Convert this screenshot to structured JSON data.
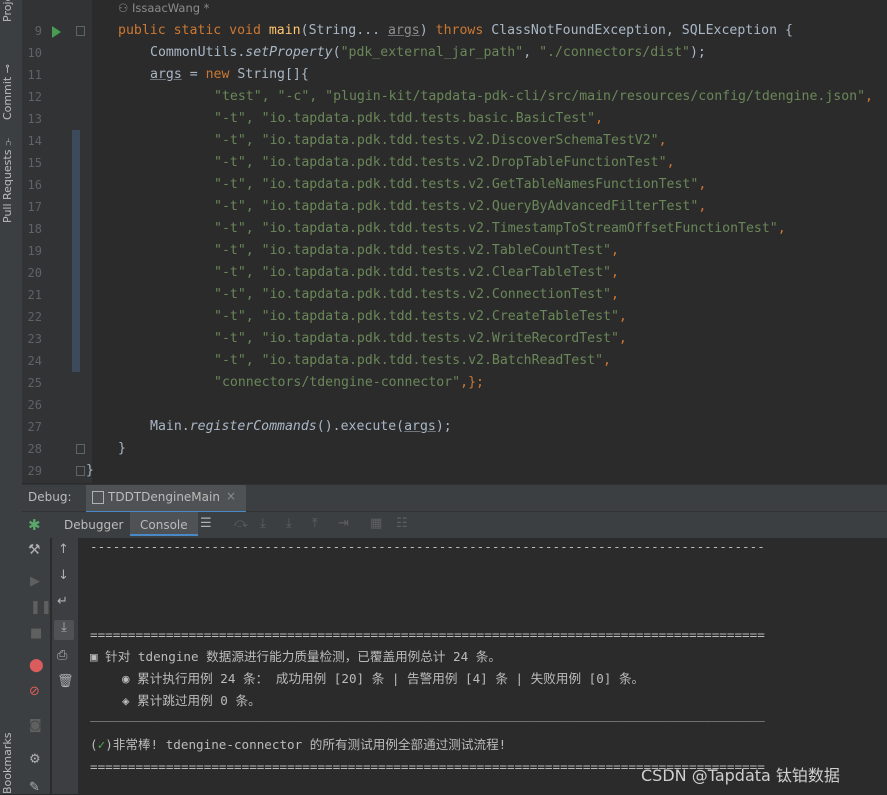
{
  "sidebar": {
    "project_label": "Project",
    "commit_label": "Commit",
    "pull_requests_label": "Pull Requests",
    "bookmarks_label": "Bookmarks"
  },
  "editor": {
    "author": "IssaacWang *",
    "line_numbers": [
      "9",
      "10",
      "11",
      "12",
      "13",
      "14",
      "15",
      "16",
      "17",
      "18",
      "19",
      "20",
      "21",
      "22",
      "23",
      "24",
      "25",
      "26",
      "27",
      "28",
      "29"
    ],
    "lines": {
      "l9": {
        "kw1": "public static void ",
        "fn": "main",
        "p1": "(String... ",
        "param": "args",
        "p2": ") ",
        "kw2": "throws ",
        "rest": "ClassNotFoundException, SQLException {"
      },
      "l10": {
        "a": "CommonUtils.",
        "fn": "setProperty",
        "b": "(",
        "s1": "\"pdk_external_jar_path\"",
        "c": ", ",
        "s2": "\"./connectors/dist\"",
        "d": ");"
      },
      "l11": {
        "param": "args",
        "a": " = ",
        "kw": "new ",
        "b": "String[]{"
      },
      "l12": {
        "s": "\"test\", \"-c\", \"plugin-kit/tapdata-pdk-cli/src/main/resources/config/tdengine.json\"",
        "c": ","
      },
      "l13": {
        "s": "\"-t\", \"io.tapdata.pdk.tdd.tests.basic.BasicTest\"",
        "c": ","
      },
      "l14": {
        "s": "\"-t\", \"io.tapdata.pdk.tdd.tests.v2.DiscoverSchemaTestV2\"",
        "c": ","
      },
      "l15": {
        "s": "\"-t\", \"io.tapdata.pdk.tdd.tests.v2.DropTableFunctionTest\"",
        "c": ","
      },
      "l16": {
        "s": "\"-t\", \"io.tapdata.pdk.tdd.tests.v2.GetTableNamesFunctionTest\"",
        "c": ","
      },
      "l17": {
        "s": "\"-t\", \"io.tapdata.pdk.tdd.tests.v2.QueryByAdvancedFilterTest\"",
        "c": ","
      },
      "l18": {
        "s": "\"-t\", \"io.tapdata.pdk.tdd.tests.v2.TimestampToStreamOffsetFunctionTest\"",
        "c": ","
      },
      "l19": {
        "s": "\"-t\", \"io.tapdata.pdk.tdd.tests.v2.TableCountTest\"",
        "c": ","
      },
      "l20": {
        "s": "\"-t\", \"io.tapdata.pdk.tdd.tests.v2.ClearTableTest\"",
        "c": ","
      },
      "l21": {
        "s": "\"-t\", \"io.tapdata.pdk.tdd.tests.v2.ConnectionTest\"",
        "c": ","
      },
      "l22": {
        "s": "\"-t\", \"io.tapdata.pdk.tdd.tests.v2.CreateTableTest\"",
        "c": ","
      },
      "l23": {
        "s": "\"-t\", \"io.tapdata.pdk.tdd.tests.v2.WriteRecordTest\"",
        "c": ","
      },
      "l24": {
        "s": "\"-t\", \"io.tapdata.pdk.tdd.tests.v2.BatchReadTest\"",
        "c": ","
      },
      "l25": {
        "s": "\"connectors/tdengine-connector\"",
        "c": ",};"
      },
      "l27": {
        "a": "Main.",
        "fn": "registerCommands",
        "b": "().execute(",
        "param": "args",
        "c": ");"
      },
      "l28": {
        "a": "}"
      },
      "l29": {
        "a": "}"
      }
    }
  },
  "debug": {
    "label": "Debug:",
    "tab_name": "TDDTDengineMain",
    "close": "×",
    "tabs": [
      "Debugger",
      "Console"
    ]
  },
  "console": {
    "dash_line": "-----------------------------------------------------------------------------------------",
    "eq_line": "=========================================================================================",
    "summary": "▣ 针对 tdengine 数据源进行能力质量检测，已覆盖用例总计 24 条。",
    "executed": "◉ 累计执行用例 24 条： 成功用例 [20] 条 | 告警用例 [4] 条 | 失败用例 [0] 条。",
    "skipped": "◈ 累计跳过用例 0 条。",
    "solid_line": "_________________________________________________________________________________________",
    "result_prefix": "(",
    "result_suffix": ")非常棒! tdengine-connector 的所有测试用例全部通过测试流程!",
    "eq_line2": "========================================================================================="
  },
  "watermark": "CSDN @Tapdata 钛铂数据",
  "colors": {
    "keyword": "#cc7832",
    "function": "#ffc66d",
    "string": "#6a8759",
    "text": "#a9b7c6",
    "check": "#4caf50"
  }
}
